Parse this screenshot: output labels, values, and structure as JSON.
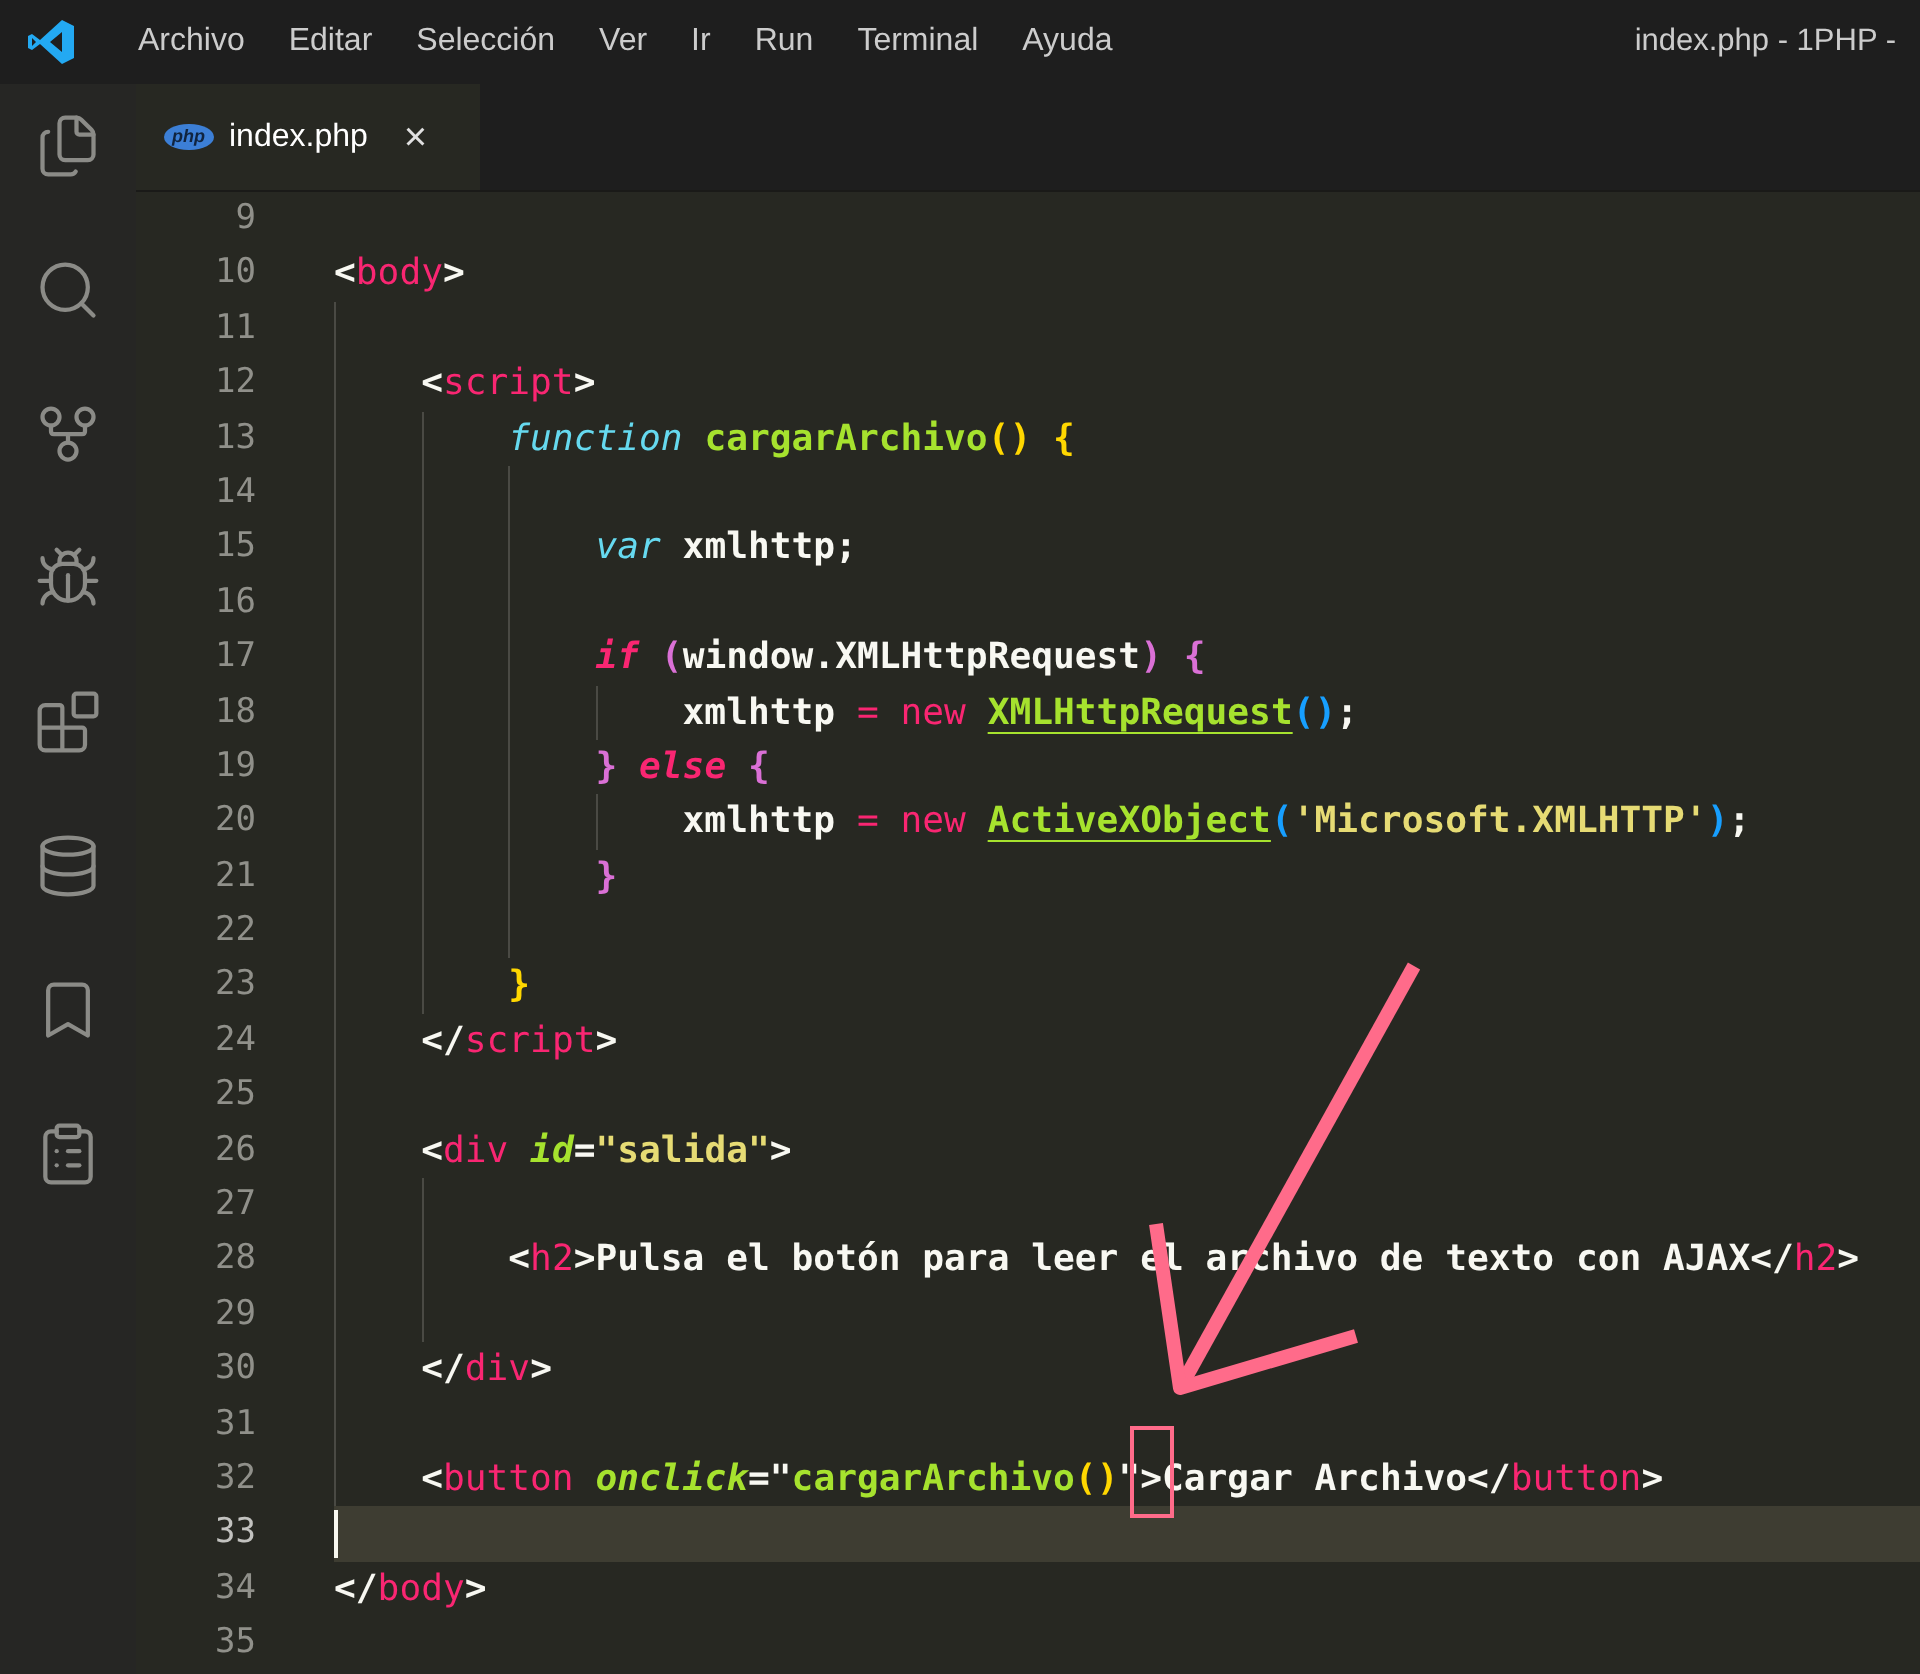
{
  "menu_bar": {
    "items": [
      "Archivo",
      "Editar",
      "Selección",
      "Ver",
      "Ir",
      "Run",
      "Terminal",
      "Ayuda"
    ],
    "window_title": "index.php - 1PHP -"
  },
  "activity_bar": {
    "items": [
      {
        "kind": "explorer",
        "selected": false
      },
      {
        "kind": "search",
        "selected": false
      },
      {
        "kind": "source-control",
        "selected": false
      },
      {
        "kind": "debug",
        "selected": false
      },
      {
        "kind": "extensions",
        "selected": false
      },
      {
        "kind": "database",
        "selected": false
      },
      {
        "kind": "bookmarks",
        "selected": false
      },
      {
        "kind": "tasks",
        "selected": false
      }
    ]
  },
  "tabs": [
    {
      "label": "index.php",
      "file_badge": "php",
      "selected": true,
      "close": "×"
    }
  ],
  "editor": {
    "lines": [
      {
        "number": "9",
        "active": false
      },
      {
        "number": "10",
        "active": false,
        "tokens": [
          {
            "kind": "punct",
            "text": "<"
          },
          {
            "kind": "tag",
            "text": "body"
          },
          {
            "kind": "punct",
            "text": ">"
          }
        ]
      },
      {
        "number": "11",
        "active": false
      },
      {
        "number": "12",
        "active": false,
        "tokens": [
          {
            "kind": "punct",
            "text": "    <"
          },
          {
            "kind": "tag",
            "text": "script"
          },
          {
            "kind": "punct",
            "text": ">"
          }
        ]
      },
      {
        "number": "13",
        "active": false,
        "tokens": [
          {
            "kind": "keyword",
            "text": "        function"
          },
          {
            "kind": "function",
            "text": " cargarArchivo"
          },
          {
            "kind": "bracket-gold",
            "text": "()"
          },
          {
            "kind": "bracket-gold",
            "text": " {"
          }
        ]
      },
      {
        "number": "14",
        "active": false
      },
      {
        "number": "15",
        "active": false,
        "tokens": [
          {
            "kind": "keyword",
            "text": "            var"
          },
          {
            "kind": "punct",
            "text": " xmlhttp;"
          }
        ]
      },
      {
        "number": "16",
        "active": false
      },
      {
        "number": "17",
        "active": false,
        "tokens": [
          {
            "kind": "keyword-pink",
            "text": "            if"
          },
          {
            "kind": "bracket-purple",
            "text": " ("
          },
          {
            "kind": "punct",
            "text": "window.XMLHttpRequest"
          },
          {
            "kind": "bracket-purple",
            "text": ")"
          },
          {
            "kind": "bracket-purple",
            "text": " {"
          }
        ]
      },
      {
        "number": "18",
        "active": false,
        "tokens": [
          {
            "kind": "punct",
            "text": "                xmlhttp"
          },
          {
            "kind": "operator",
            "text": " = new "
          },
          {
            "kind": "class",
            "text": "XMLHttpRequest"
          },
          {
            "kind": "bracket-blue",
            "text": "()"
          },
          {
            "kind": "punct",
            "text": ";"
          }
        ]
      },
      {
        "number": "19",
        "active": false,
        "tokens": [
          {
            "kind": "bracket-purple",
            "text": "            }"
          },
          {
            "kind": "keyword-pink",
            "text": " else"
          },
          {
            "kind": "bracket-purple",
            "text": " {"
          }
        ]
      },
      {
        "number": "20",
        "active": false,
        "tokens": [
          {
            "kind": "punct",
            "text": "                xmlhttp"
          },
          {
            "kind": "operator",
            "text": " = new "
          },
          {
            "kind": "class",
            "text": "ActiveXObject"
          },
          {
            "kind": "bracket-blue",
            "text": "("
          },
          {
            "kind": "string",
            "text": "'Microsoft.XMLHTTP'"
          },
          {
            "kind": "bracket-blue",
            "text": ")"
          },
          {
            "kind": "punct",
            "text": ";"
          }
        ]
      },
      {
        "number": "21",
        "active": false,
        "tokens": [
          {
            "kind": "bracket-purple",
            "text": "            }"
          }
        ]
      },
      {
        "number": "22",
        "active": false
      },
      {
        "number": "23",
        "active": false,
        "tokens": [
          {
            "kind": "bracket-gold",
            "text": "        }"
          }
        ]
      },
      {
        "number": "24",
        "active": false,
        "tokens": [
          {
            "kind": "punct",
            "text": "    </"
          },
          {
            "kind": "tag",
            "text": "script"
          },
          {
            "kind": "punct",
            "text": ">"
          }
        ]
      },
      {
        "number": "25",
        "active": false
      },
      {
        "number": "26",
        "active": false,
        "tokens": [
          {
            "kind": "punct",
            "text": "    <"
          },
          {
            "kind": "tag",
            "text": "div"
          },
          {
            "kind": "attribute",
            "text": " id"
          },
          {
            "kind": "punct",
            "text": "="
          },
          {
            "kind": "string",
            "text": "\"salida\""
          },
          {
            "kind": "punct",
            "text": ">"
          }
        ]
      },
      {
        "number": "27",
        "active": false
      },
      {
        "number": "28",
        "active": false,
        "tokens": [
          {
            "kind": "punct",
            "text": "        <"
          },
          {
            "kind": "tag",
            "text": "h2"
          },
          {
            "kind": "punct",
            "text": ">Pulsa el botón para leer el archivo de texto con AJAX</"
          },
          {
            "kind": "tag",
            "text": "h2"
          },
          {
            "kind": "punct",
            "text": ">"
          }
        ]
      },
      {
        "number": "29",
        "active": false
      },
      {
        "number": "30",
        "active": false,
        "tokens": [
          {
            "kind": "punct",
            "text": "    </"
          },
          {
            "kind": "tag",
            "text": "div"
          },
          {
            "kind": "punct",
            "text": ">"
          }
        ]
      },
      {
        "number": "31",
        "active": false
      },
      {
        "number": "32",
        "active": false,
        "tokens": [
          {
            "kind": "punct",
            "text": "    <"
          },
          {
            "kind": "tag",
            "text": "button"
          },
          {
            "kind": "attribute",
            "text": " onclick"
          },
          {
            "kind": "punct",
            "text": "=\""
          },
          {
            "kind": "function",
            "text": "cargarArchivo"
          },
          {
            "kind": "bracket-gold",
            "text": "()"
          },
          {
            "kind": "punct",
            "text": "\">Cargar Archivo</"
          },
          {
            "kind": "tag",
            "text": "button"
          },
          {
            "kind": "punct",
            "text": ">"
          }
        ]
      },
      {
        "number": "33",
        "active": true
      },
      {
        "number": "34",
        "active": false,
        "tokens": [
          {
            "kind": "punct",
            "text": "</"
          },
          {
            "kind": "tag",
            "text": "body"
          },
          {
            "kind": "punct",
            "text": ">"
          }
        ]
      },
      {
        "number": "35",
        "active": false
      }
    ]
  }
}
